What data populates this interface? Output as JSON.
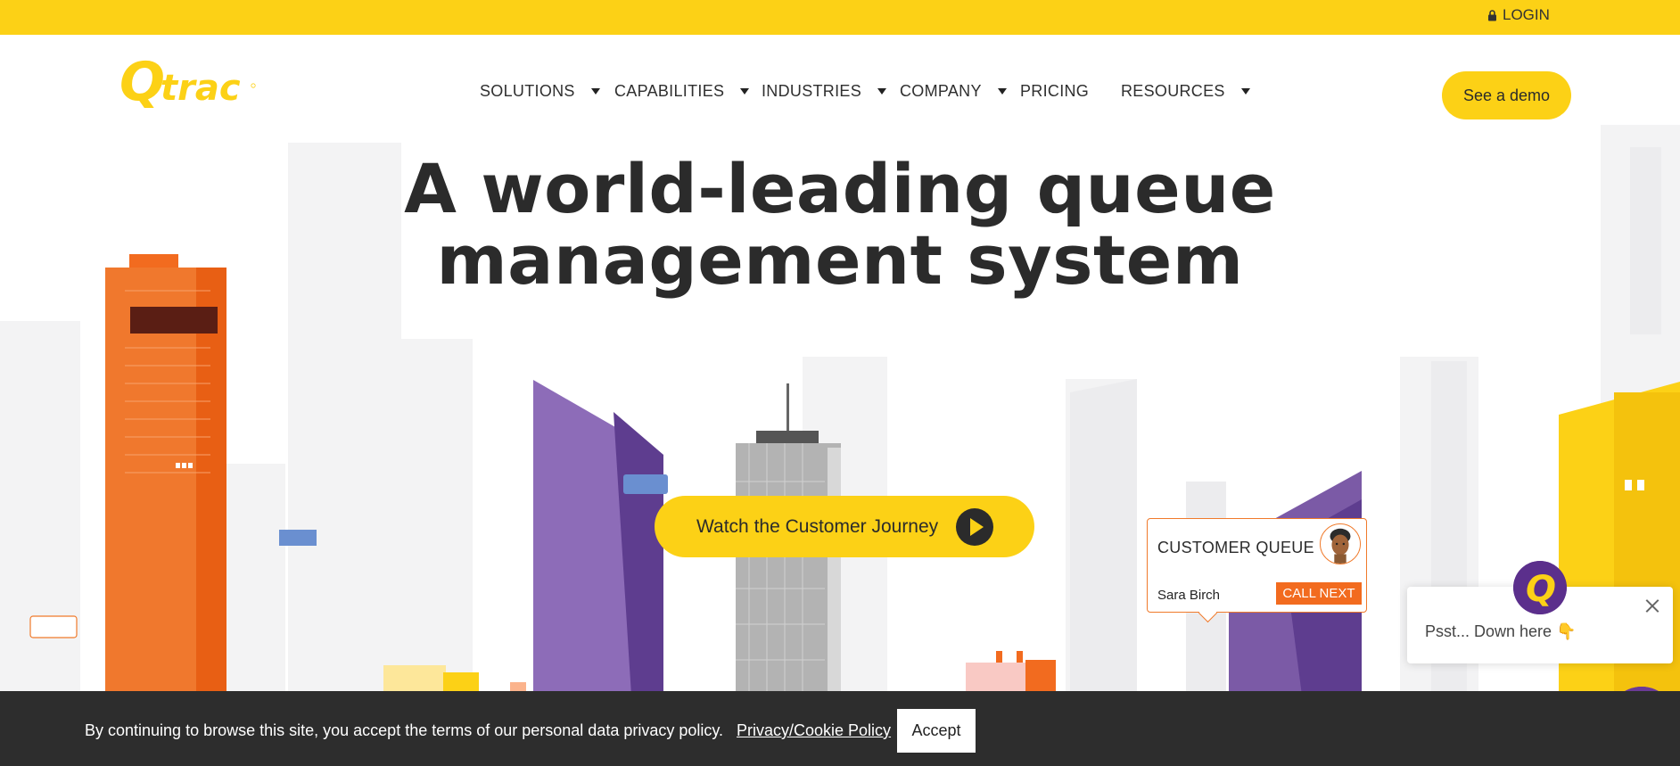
{
  "topbar": {
    "login_label": "LOGIN"
  },
  "header": {
    "logo_text": "Qtrac",
    "nav": [
      {
        "label": "SOLUTIONS",
        "has_dropdown": true
      },
      {
        "label": "CAPABILITIES",
        "has_dropdown": true
      },
      {
        "label": "INDUSTRIES",
        "has_dropdown": true
      },
      {
        "label": "COMPANY",
        "has_dropdown": true
      },
      {
        "label": "PRICING",
        "has_dropdown": false
      },
      {
        "label": "RESOURCES",
        "has_dropdown": true
      }
    ],
    "demo_label": "See a demo"
  },
  "hero": {
    "title_line1": "A world-leading queue",
    "title_line2": "management system",
    "watch_label": "Watch the Customer Journey"
  },
  "queue_card": {
    "title": "CUSTOMER QUEUE",
    "customer_name": "Sara Birch",
    "call_next_label": "CALL NEXT"
  },
  "chat": {
    "message": "Psst... Down here 👇"
  },
  "cookie": {
    "text": "By continuing to browse this site, you accept the terms of our personal data privacy policy.",
    "link_label": "Privacy/Cookie Policy",
    "accept_label": "Accept"
  },
  "colors": {
    "brand_yellow": "#fcd116",
    "orange": "#f26b1f",
    "purple": "#7b5aa6",
    "dark": "#2d2d2d"
  }
}
